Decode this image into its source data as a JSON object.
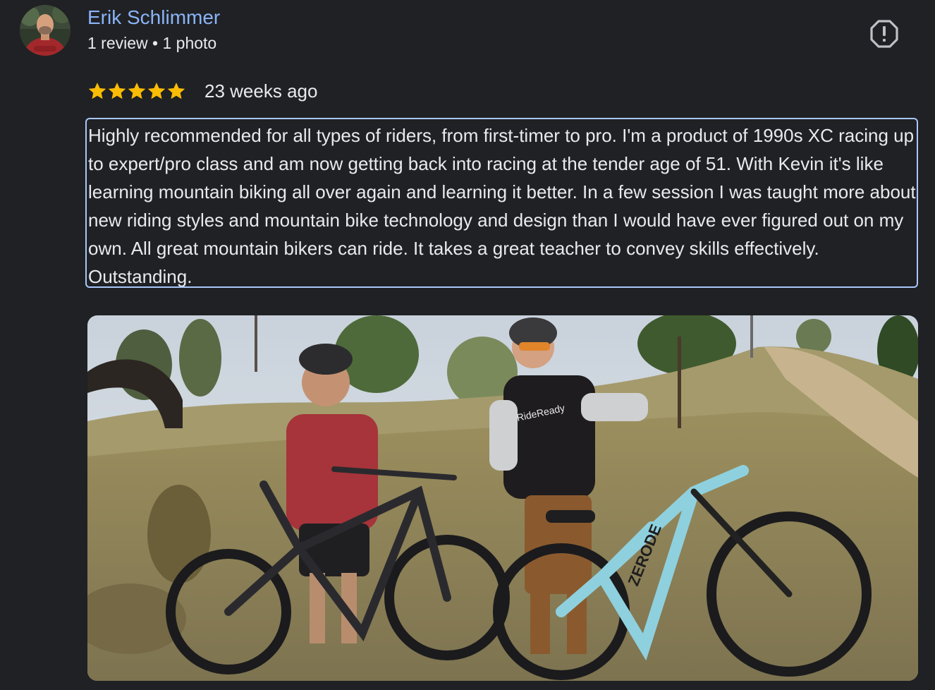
{
  "author": {
    "name": "Erik Schlimmer",
    "meta": "1 review • 1 photo",
    "avatar_icon": "profile-photo"
  },
  "report": {
    "icon": "report-flag-icon"
  },
  "rating": {
    "stars": 5,
    "max": 5,
    "star_color": "#fbbc04",
    "date": "23 weeks ago"
  },
  "review": {
    "text": "Highly recommended for all types of riders, from first-timer to pro. I'm a product of 1990s XC racing up to expert/pro class and am now getting back into racing at the tender age of 51. With Kevin it's like learning mountain biking all over again and learning it better. In a few session I was taught more about new riding styles and mountain bike technology and design than I would have ever figured out on my own. All great mountain bikers can ride. It takes a great teacher to convey skills effectively. Outstanding.",
    "focus_border_color": "#a8c7fa"
  },
  "photo": {
    "jersey_text": "RideReady",
    "bike_brand": "ZERODE"
  },
  "colors": {
    "background": "#202124",
    "link": "#8ab4f8",
    "text": "#e8eaed"
  }
}
